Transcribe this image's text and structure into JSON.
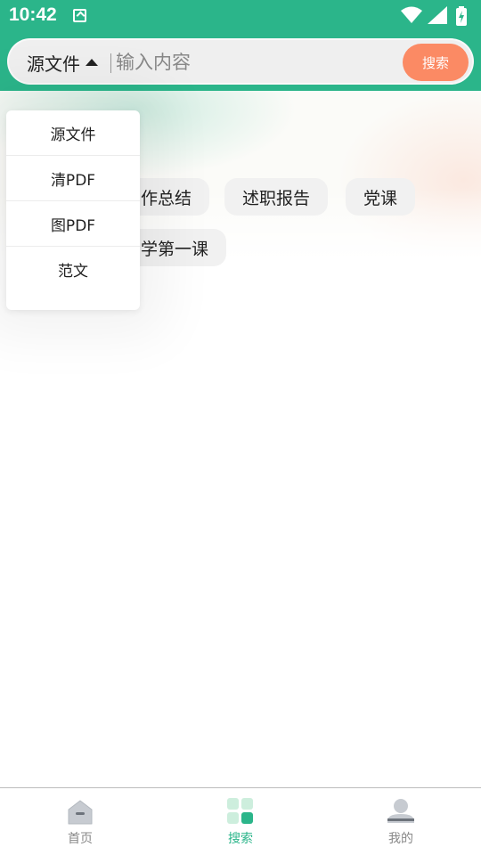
{
  "status_bar": {
    "time": "10:42"
  },
  "search": {
    "scope_label": "源文件",
    "placeholder": "输入内容",
    "button_label": "搜索"
  },
  "dropdown": {
    "options": [
      "源文件",
      "清PDF",
      "图PDF",
      "范文"
    ]
  },
  "hot_tags": {
    "tags": [
      "作总结",
      "述职报告",
      "党课",
      "学第一课"
    ]
  },
  "bottom_nav": {
    "items": [
      {
        "label": "首页",
        "icon": "home-icon",
        "active": false
      },
      {
        "label": "搜索",
        "icon": "grid-icon",
        "active": true
      },
      {
        "label": "我的",
        "icon": "user-icon",
        "active": false
      }
    ]
  },
  "colors": {
    "brand_green": "#2bb58a",
    "search_button": "#fb8a64",
    "inactive_gray": "#888888"
  }
}
